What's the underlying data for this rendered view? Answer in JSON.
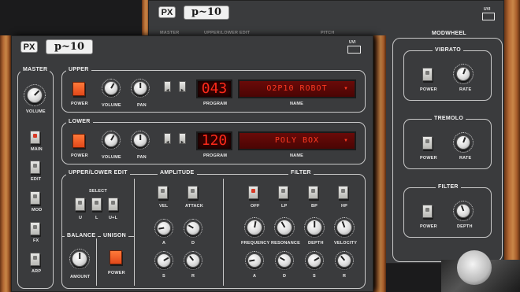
{
  "back": {
    "logo_px": "PX",
    "logo_p10": "p~10",
    "uvi": "UVI",
    "header_master": "MASTER",
    "header_edit": "UPPER/LOWER EDIT",
    "header_pitch": "PITCH",
    "modwheel": {
      "title": "MODWHEEL",
      "vibrato": {
        "title": "VIBRATO",
        "power": "POWER",
        "rate": "RATE"
      },
      "tremolo": {
        "title": "TREMOLO",
        "power": "POWER",
        "rate": "RATE"
      },
      "filter": {
        "title": "FILTER",
        "power": "POWER",
        "depth": "DEPTH"
      }
    }
  },
  "front": {
    "logo_px": "PX",
    "logo_p10": "p~10",
    "uvi": "UVI",
    "master": {
      "title": "MASTER",
      "volume": "VOLUME",
      "buttons": [
        "MAIN",
        "EDIT",
        "MOD",
        "FX",
        "ARP"
      ]
    },
    "upper": {
      "title": "UPPER",
      "power": "POWER",
      "volume": "VOLUME",
      "pan": "PAN",
      "program_label": "PROGRAM",
      "program": "043",
      "name_label": "NAME",
      "name": "O2P10 ROBOT"
    },
    "lower": {
      "title": "LOWER",
      "power": "POWER",
      "volume": "VOLUME",
      "pan": "PAN",
      "program_label": "PROGRAM",
      "program": "120",
      "name_label": "NAME",
      "name": "POLY BOX"
    },
    "edit": {
      "title": "UPPER/LOWER EDIT",
      "select": "SELECT",
      "u": "U",
      "l": "L",
      "ul": "U+L"
    },
    "balance": {
      "title": "BALANCE",
      "amount": "AMOUNT"
    },
    "unison": {
      "title": "UNISON",
      "power": "POWER"
    },
    "amplitude": {
      "title": "AMPLITUDE",
      "vel": "VEL",
      "attack": "ATTACK",
      "a": "A",
      "d": "D",
      "s": "S",
      "r": "R"
    },
    "filter": {
      "title": "FILTER",
      "off": "OFF",
      "lp": "LP",
      "bp": "BP",
      "hp": "HP",
      "frequency": "FREQUENCY",
      "resonance": "RESONANCE",
      "depth": "DEPTH",
      "velocity": "VELOCITY",
      "a": "A",
      "d": "D",
      "s": "S",
      "r": "R"
    }
  }
}
